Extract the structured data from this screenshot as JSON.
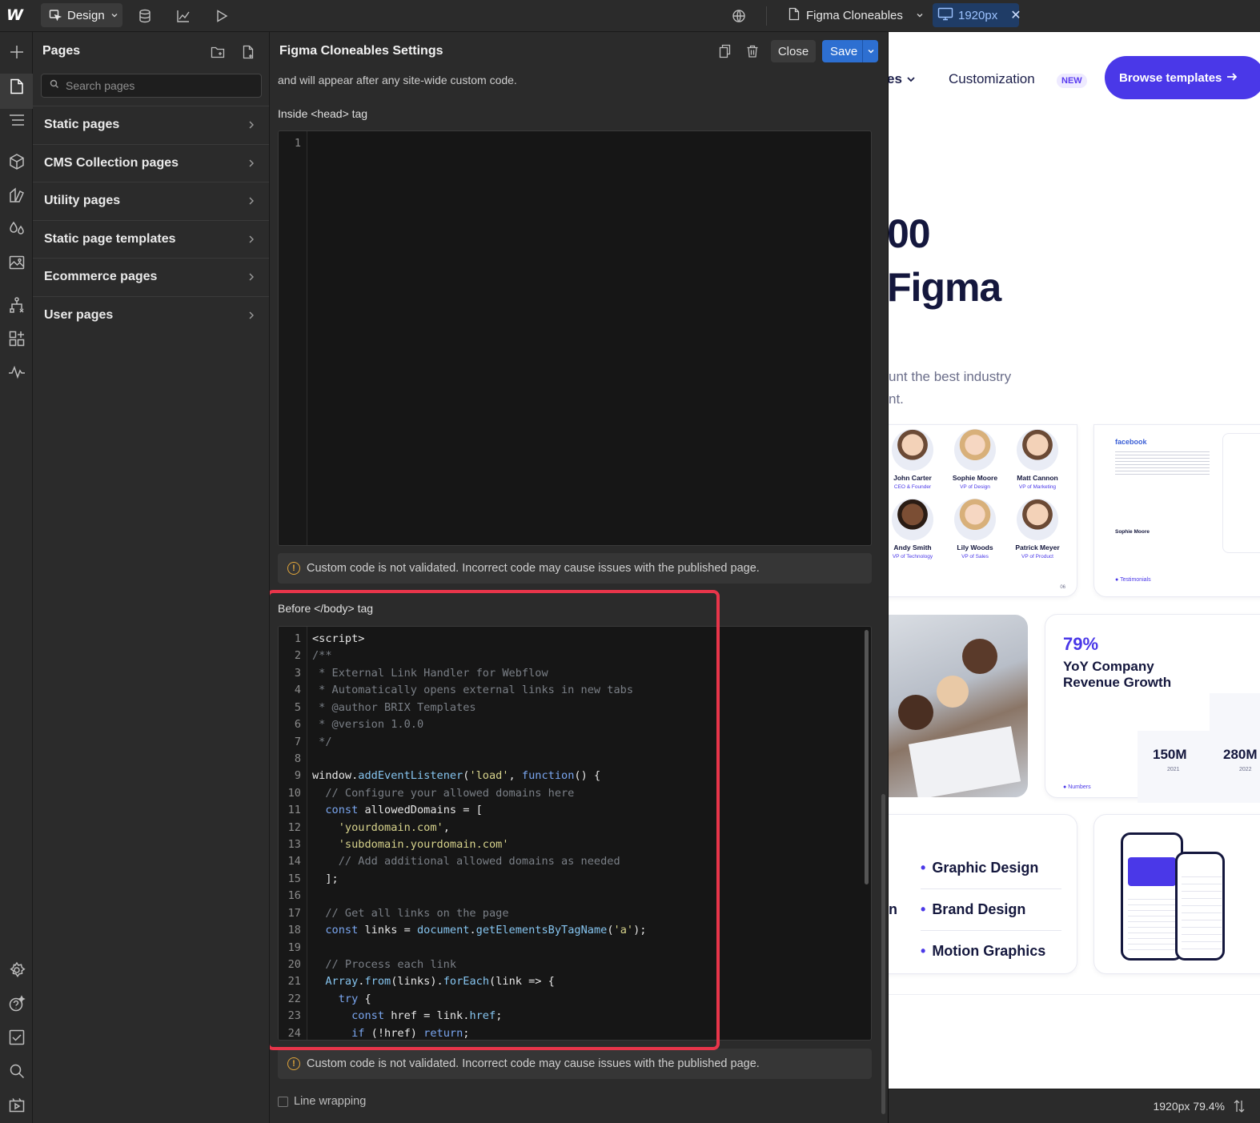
{
  "topbar": {
    "logo": "W",
    "mode_label": "Design",
    "page_name": "Figma Cloneables",
    "breakpoint": "1920px"
  },
  "pages_panel": {
    "title": "Pages",
    "search_placeholder": "Search pages",
    "groups": [
      {
        "label": "Static pages"
      },
      {
        "label": "CMS Collection pages"
      },
      {
        "label": "Utility pages"
      },
      {
        "label": "Static page templates"
      },
      {
        "label": "Ecommerce pages"
      },
      {
        "label": "User pages"
      }
    ]
  },
  "settings": {
    "title": "Figma Cloneables Settings",
    "close_label": "Close",
    "save_label": "Save",
    "intro_text": "and will appear after any site-wide custom code.",
    "head_label": "Inside <head> tag",
    "body_label": "Before </body> tag",
    "warning_text": "Custom code is not validated. Incorrect code may cause issues with the published page.",
    "line_wrapping_label": "Line wrapping",
    "head_code_lines": [
      "1"
    ],
    "body_code": [
      {
        "n": "1",
        "text": "<script>"
      },
      {
        "n": "2",
        "text": "/**"
      },
      {
        "n": "3",
        "text": " * External Link Handler for Webflow"
      },
      {
        "n": "4",
        "text": " * Automatically opens external links in new tabs"
      },
      {
        "n": "5",
        "text": " * @author BRIX Templates"
      },
      {
        "n": "6",
        "text": " * @version 1.0.0"
      },
      {
        "n": "7",
        "text": " */"
      },
      {
        "n": "8",
        "text": ""
      },
      {
        "n": "9",
        "text": "window.addEventListener('load', function() {"
      },
      {
        "n": "10",
        "text": "  // Configure your allowed domains here"
      },
      {
        "n": "11",
        "text": "  const allowedDomains = ["
      },
      {
        "n": "12",
        "text": "    'yourdomain.com',"
      },
      {
        "n": "13",
        "text": "    'subdomain.yourdomain.com'"
      },
      {
        "n": "14",
        "text": "    // Add additional allowed domains as needed"
      },
      {
        "n": "15",
        "text": "  ];"
      },
      {
        "n": "16",
        "text": ""
      },
      {
        "n": "17",
        "text": "  // Get all links on the page"
      },
      {
        "n": "18",
        "text": "  const links = document.getElementsByTagName('a');"
      },
      {
        "n": "19",
        "text": ""
      },
      {
        "n": "20",
        "text": "  // Process each link"
      },
      {
        "n": "21",
        "text": "  Array.from(links).forEach(link => {"
      },
      {
        "n": "22",
        "text": "    try {"
      },
      {
        "n": "23",
        "text": "      const href = link.href;"
      },
      {
        "n": "24",
        "text": "      if (!href) return;"
      }
    ]
  },
  "canvas": {
    "nav_dropdown_fragment": "es",
    "nav_customization": "Customization",
    "nav_new_badge": "NEW",
    "browse_button": "Browse templates",
    "hero_line1": "00",
    "hero_line2": "Figma",
    "sub_line1": "unt the best industry",
    "sub_line2": "nt.",
    "team": [
      {
        "name": "John Carter",
        "role": "CEO & Founder"
      },
      {
        "name": "Sophie Moore",
        "role": "VP of Design"
      },
      {
        "name": "Matt Cannon",
        "role": "VP of Marketing"
      },
      {
        "name": "Andy Smith",
        "role": "VP of Technology"
      },
      {
        "name": "Lily Woods",
        "role": "VP of Sales"
      },
      {
        "name": "Patrick Meyer",
        "role": "VP of Product"
      }
    ],
    "team_page_num": "06",
    "testimonial_brand": "facebook",
    "testimonial_author": "Sophie Moore",
    "testimonials_tag": "Testimonials",
    "stat_percent": "79%",
    "stat_title": "YoY Company Revenue Growth",
    "bars": [
      {
        "value": "150M",
        "year": "2021"
      },
      {
        "value": "280M",
        "year": "2022"
      }
    ],
    "numbers_tag": "Numbers",
    "services": [
      "Graphic Design",
      "Brand Design",
      "Motion Graphics"
    ],
    "services_fragment": "n"
  },
  "statusbar": {
    "text": "1920px 79.4%"
  },
  "colors": {
    "accent": "#2d6fd1",
    "highlight": "#e8354a",
    "canvas_brand": "#4a38e8",
    "warning": "#e0a53a"
  },
  "icons": {
    "rail": [
      "add-icon",
      "pages-icon",
      "navigator-icon",
      "components-icon",
      "styles-icon",
      "variables-icon",
      "assets-icon",
      "logic-icon",
      "apps-icon",
      "insights-icon",
      "settings-icon",
      "help-icon",
      "audit-icon",
      "search-icon",
      "video-icon"
    ]
  }
}
